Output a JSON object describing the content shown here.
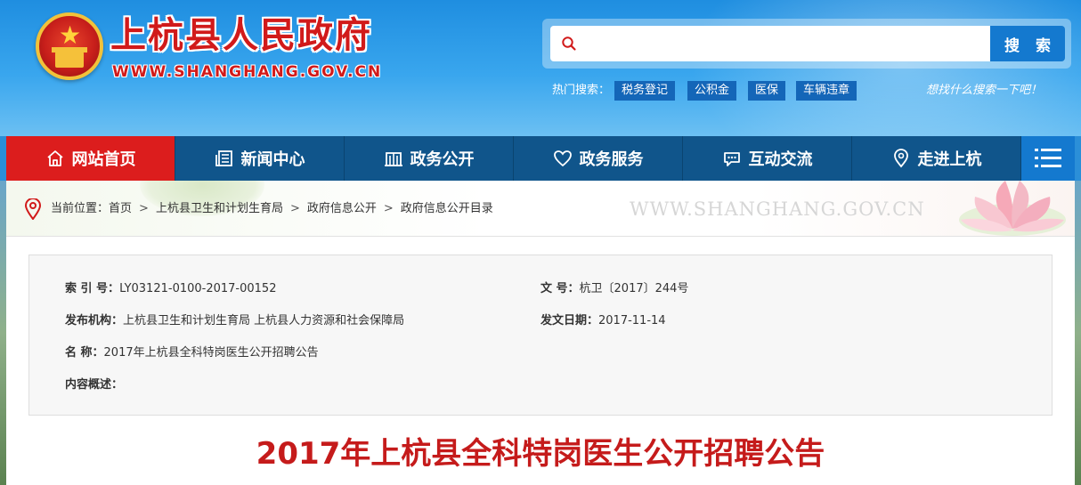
{
  "header": {
    "title": "上杭县人民政府",
    "url_text": "WWW.SHANGHANG.GOV.CN",
    "slogan": "想找什么搜索一下吧！"
  },
  "search": {
    "placeholder": "",
    "value": "",
    "button_label": "搜 索",
    "hot_label": "热门搜索：",
    "hot_tags": [
      "税务登记",
      "公积金",
      "医保",
      "车辆违章"
    ]
  },
  "nav": {
    "items": [
      {
        "label": "网站首页",
        "icon": "home-icon",
        "active": true
      },
      {
        "label": "新闻中心",
        "icon": "newspaper-icon",
        "active": false
      },
      {
        "label": "政务公开",
        "icon": "building-icon",
        "active": false
      },
      {
        "label": "政务服务",
        "icon": "heart-icon",
        "active": false
      },
      {
        "label": "互动交流",
        "icon": "chat-icon",
        "active": false
      },
      {
        "label": "走进上杭",
        "icon": "location-icon",
        "active": false
      }
    ],
    "menu_icon": "hamburger-icon"
  },
  "breadcrumb": {
    "prefix": "当前位置：",
    "items": [
      "首页",
      "上杭县卫生和计划生育局",
      "政府信息公开",
      "政府信息公开目录"
    ],
    "separator": ">",
    "watermark": "WWW.SHANGHANG.GOV.CN"
  },
  "meta": {
    "index_label": "索 引 号：",
    "index_value": "LY03121-0100-2017-00152",
    "doc_no_label": "文 号：",
    "doc_no_value": "杭卫〔2017〕244号",
    "publisher_label": "发布机构：",
    "publisher_value": "上杭县卫生和计划生育局 上杭县人力资源和社会保障局",
    "date_label": "发文日期：",
    "date_value": "2017-11-14",
    "name_label": "名 称：",
    "name_value": "2017年上杭县全科特岗医生公开招聘公告",
    "summary_label": "内容概述：",
    "summary_value": ""
  },
  "article": {
    "title": "2017年上杭县全科特岗医生公开招聘公告"
  },
  "colors": {
    "nav_bg": "#10558b",
    "nav_active": "#dc1d1d",
    "title_red": "#c51b1b",
    "search_button": "#1479cf"
  }
}
